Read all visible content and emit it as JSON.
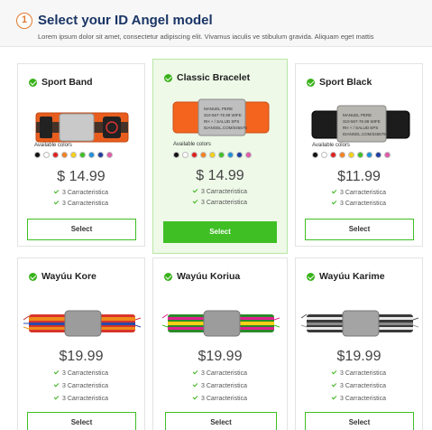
{
  "header": {
    "step": "1",
    "title": "Select your ID Angel model",
    "subtitle": "Lorem ipsum dolor sit amet, consectetur adipiscing elit. Vivamus iaculis ve stibulum gravida. Aliquam eget mattis"
  },
  "colors": {
    "accent_green": "#3fbf24",
    "title_blue": "#1a3566",
    "step_orange": "#e07a2e"
  },
  "color_swatches": [
    "#111111",
    "#ffffff",
    "#e02020",
    "#f58220",
    "#f7d117",
    "#3fbf24",
    "#1e90d8",
    "#1d3e9e",
    "#e25aa8"
  ],
  "cards": [
    {
      "name": "Sport Band",
      "available_label": "Available colors",
      "price": "$ 14.99",
      "features": [
        "3 Carracteristica",
        "3 Carracteristica"
      ],
      "button": "Select"
    },
    {
      "name": "Classic Bracelet",
      "available_label": "Available colors",
      "price": "$ 14.99",
      "features": [
        "3 Carracteristica",
        "3 Carracteristica"
      ],
      "button": "Select"
    },
    {
      "name": "Sport Black",
      "available_label": "Available colors",
      "price": "$11.99",
      "features": [
        "3 Carracteristica",
        "3 Carracteristica"
      ],
      "button": "Select"
    },
    {
      "name": "Wayúu Kore",
      "price": "$19.99",
      "features": [
        "3 Carracteristica",
        "3 Carracteristica",
        "3 Carracteristica"
      ],
      "button": "Select"
    },
    {
      "name": "Wayúu Koriua",
      "price": "$19.99",
      "features": [
        "3 Carracteristica",
        "3 Carracteristica",
        "3 Carracteristica"
      ],
      "button": "Select"
    },
    {
      "name": "Wayúu Karime",
      "price": "$19.99",
      "features": [
        "3 Carracteristica",
        "3 Carracteristica",
        "3 Carracteristica"
      ],
      "button": "Select"
    }
  ],
  "plate_text": {
    "sport_band": [
      "RD"
    ],
    "classic": [
      "MANUEL PERE",
      "310-567-76 89 WIFE",
      "RH + / SALUD SPS",
      "IDANGEL.COM/345678"
    ],
    "sport_black": [
      "MANUEL PERE",
      "310-567-76 89 WIFE",
      "RH + / SALUD EPS",
      "IDANGEL.COM/345678"
    ]
  }
}
